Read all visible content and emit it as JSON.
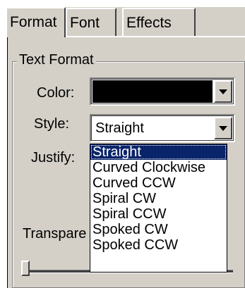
{
  "tabs": [
    {
      "label": "Format"
    },
    {
      "label": "Font"
    },
    {
      "label": "Effects"
    }
  ],
  "group": {
    "title": "Text Format"
  },
  "fields": {
    "color_label": "Color:",
    "color_value": "#000000",
    "style_label": "Style:",
    "style_value": "Straight",
    "justify_label": "Justify:",
    "transparency_label": "Transpare"
  },
  "style_options": [
    "Straight",
    "Curved Clockwise",
    "Curved CCW",
    "Spiral CW",
    "Spiral CCW",
    "Spoked CW",
    "Spoked CCW"
  ],
  "transparency": {
    "value": 0
  }
}
